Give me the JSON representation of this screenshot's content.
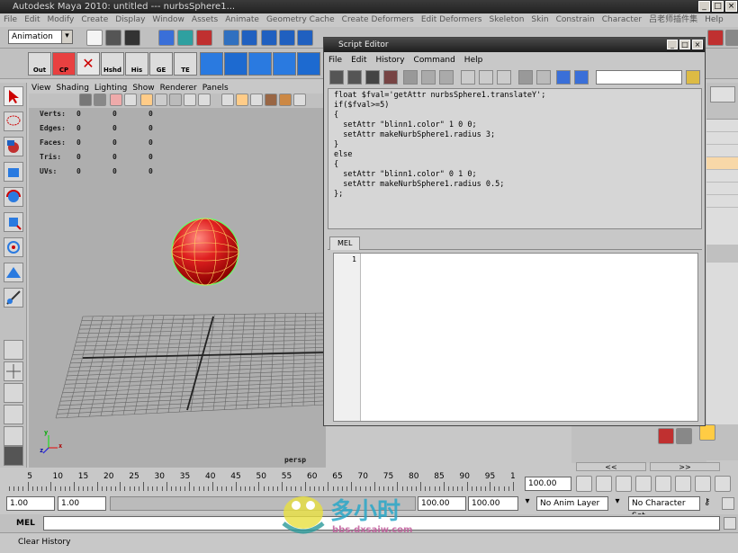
{
  "window": {
    "title": "Autodesk Maya 2010: untitled   ---   nurbsSphere1...",
    "min_label": "_",
    "max_label": "□",
    "close_label": "×"
  },
  "menubar": [
    "File",
    "Edit",
    "Modify",
    "Create",
    "Display",
    "Window",
    "Assets",
    "Animate",
    "Geometry Cache",
    "Create Deformers",
    "Edit Deformers",
    "Skeleton",
    "Skin",
    "Constrain",
    "Character",
    "吕老师插件集",
    "Help"
  ],
  "status_line": {
    "mode": "Animation"
  },
  "shelf": {
    "buttons": [
      "Out",
      "CP",
      "",
      "Hshd",
      "His",
      "GE",
      "TE"
    ]
  },
  "viewport": {
    "menu": [
      "View",
      "Shading",
      "Lighting",
      "Show",
      "Renderer",
      "Panels"
    ],
    "hud": {
      "labels": [
        "Verts:",
        "Edges:",
        "Faces:",
        "Tris:",
        "UVs:"
      ],
      "col1": [
        "0",
        "0",
        "0",
        "0",
        "0"
      ],
      "col2": [
        "0",
        "0",
        "0",
        "0",
        "0"
      ],
      "col3": [
        "0",
        "0",
        "0",
        "0",
        "0"
      ]
    },
    "camera_label": "persp",
    "axis_labels": {
      "y": "y",
      "z": "z",
      "x": "x"
    }
  },
  "script_editor": {
    "title": "Script Editor",
    "menu": [
      "File",
      "Edit",
      "History",
      "Command",
      "Help"
    ],
    "history_lines": [
      "float $fval='getAttr nurbsSphere1.translateY';",
      "if($fval>=5)",
      "{",
      "  setAttr \"blinn1.color\" 1 0 0;",
      "  setAttr makeNurbSphere1.radius 3;",
      "}",
      "else",
      "{",
      "  setAttr \"blinn1.color\" 0 1 0;",
      "  setAttr makeNurbSphere1.radius 0.5;",
      "};"
    ],
    "tab_label": "MEL",
    "line_number": "1",
    "search_value": ""
  },
  "timeline": {
    "ticks": [
      "5",
      "10",
      "15",
      "20",
      "25",
      "30",
      "35",
      "40",
      "45",
      "50",
      "55",
      "60",
      "65",
      "70",
      "75",
      "80",
      "85",
      "90",
      "95",
      "1"
    ],
    "current_time": "100.00",
    "nav_prev": "<<",
    "nav_next": ">>"
  },
  "range": {
    "start": "1.00",
    "playback_start": "1.00",
    "playback_end": "100.00",
    "end": "100.00",
    "anim_layer": "No Anim Layer",
    "character_set": "No Character Set"
  },
  "command_line": {
    "label": "MEL",
    "value": ""
  },
  "help_line": {
    "text": "Clear History"
  },
  "watermark": {
    "text": "多小时",
    "url": "bbs.dxsaiw.com"
  },
  "colors": {
    "sphere": "#e02020",
    "wire": "#66ff66",
    "grid": "#666666"
  }
}
